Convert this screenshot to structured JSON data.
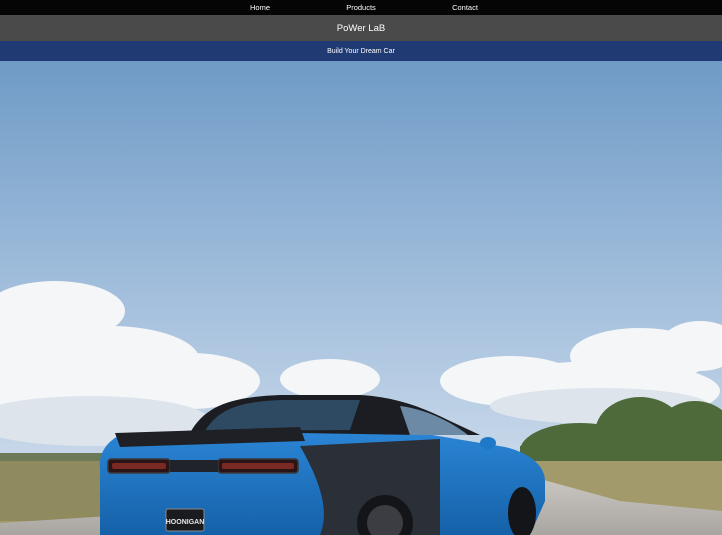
{
  "nav": {
    "items": [
      {
        "label": "Home"
      },
      {
        "label": "Products"
      },
      {
        "label": "Contact"
      }
    ]
  },
  "brand": {
    "title": "PoWer LaB"
  },
  "banner": {
    "tagline": "Build Your Dream Car"
  },
  "hero": {
    "image_description": "blue muscle car on road under cloudy sky",
    "plate_text": "HOONIGAN",
    "colors": {
      "sky_top": "#6f9bc6",
      "sky_bottom": "#cfdceb",
      "car_body": "#1f78c8",
      "car_dark": "#1b1d22",
      "foliage": "#4e6a3a",
      "grass": "#a39a6c",
      "road": "#b7b4b0"
    }
  }
}
